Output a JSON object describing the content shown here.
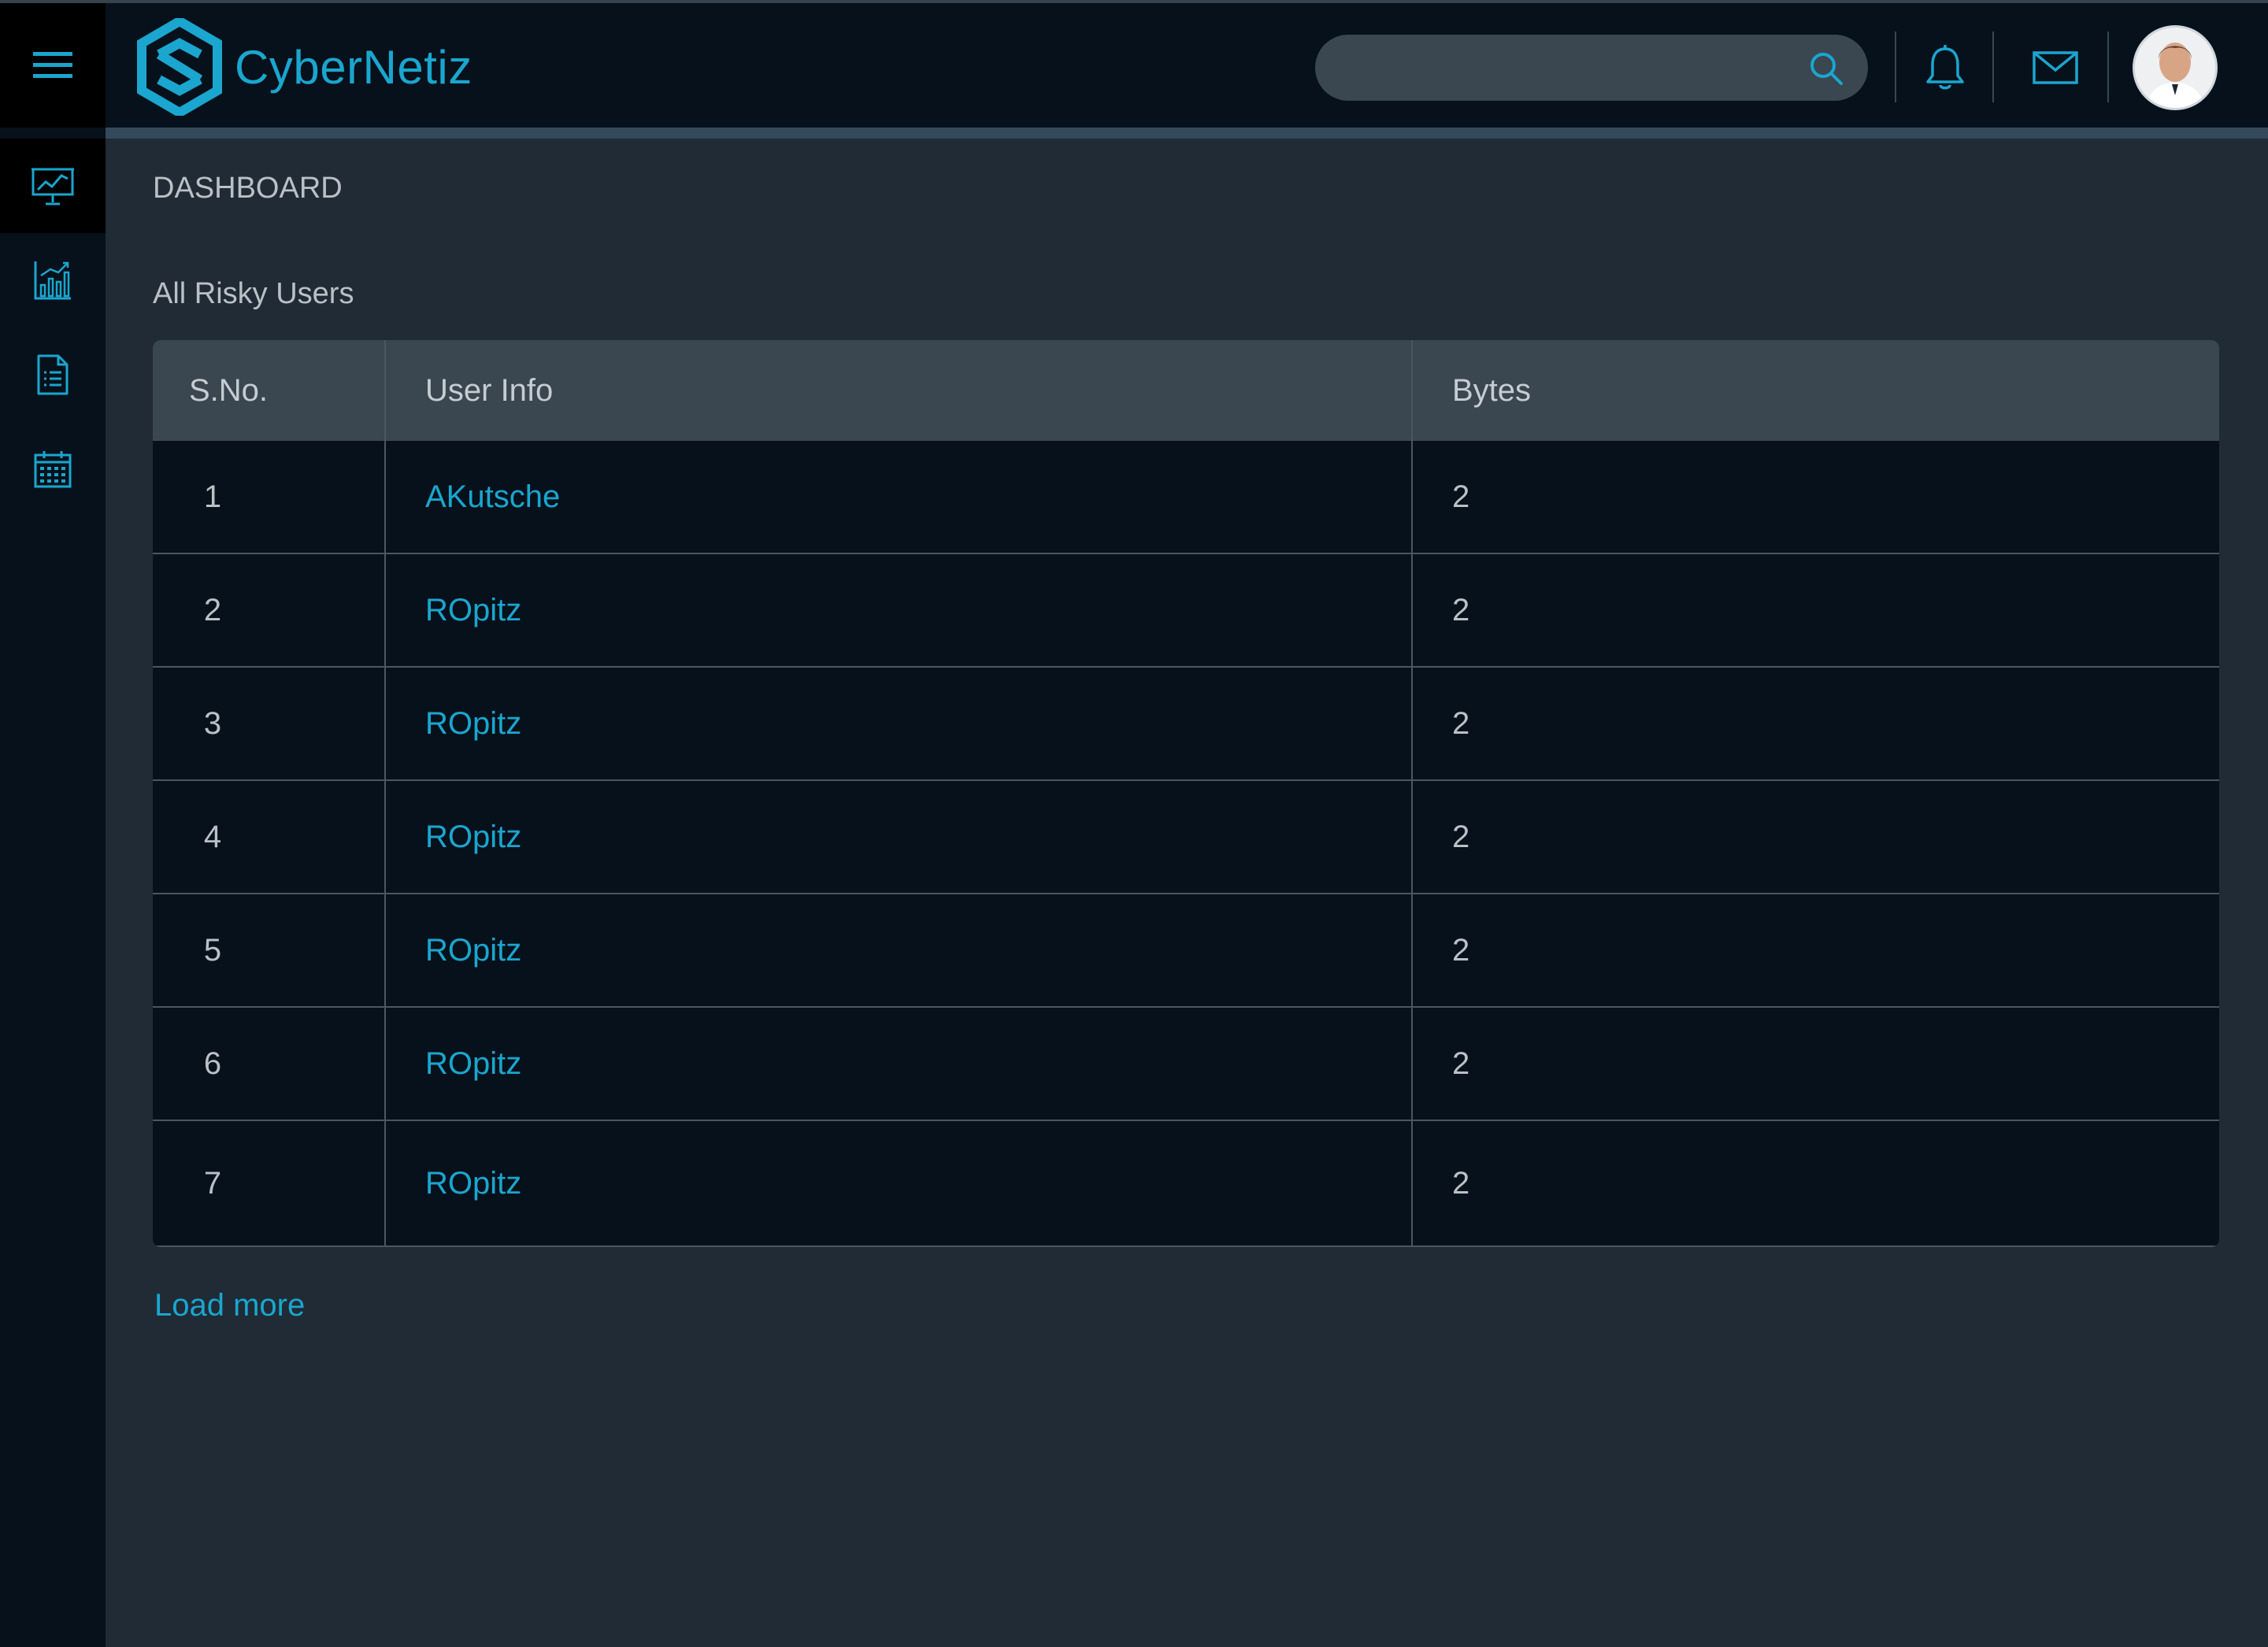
{
  "app": {
    "brand": "CyberNetiz"
  },
  "search": {
    "placeholder": "",
    "value": ""
  },
  "sidebar": {
    "items": [
      {
        "icon": "presentation-chart-icon",
        "active": true
      },
      {
        "icon": "bar-chart-icon",
        "active": false
      },
      {
        "icon": "document-list-icon",
        "active": false
      },
      {
        "icon": "calendar-icon",
        "active": false
      }
    ]
  },
  "page": {
    "title": "DASHBOARD"
  },
  "section": {
    "title": "All Risky Users"
  },
  "table": {
    "columns": [
      "S.No.",
      "User Info",
      "Bytes"
    ],
    "rows": [
      {
        "sno": "1",
        "user": "AKutsche",
        "bytes": "2"
      },
      {
        "sno": "2",
        "user": "ROpitz",
        "bytes": "2"
      },
      {
        "sno": "3",
        "user": "ROpitz",
        "bytes": "2"
      },
      {
        "sno": "4",
        "user": "ROpitz",
        "bytes": "2"
      },
      {
        "sno": "5",
        "user": "ROpitz",
        "bytes": "2"
      },
      {
        "sno": "6",
        "user": "ROpitz",
        "bytes": "2"
      },
      {
        "sno": "7",
        "user": "ROpitz",
        "bytes": "2"
      }
    ]
  },
  "actions": {
    "load_more": "Load more"
  },
  "colors": {
    "accent": "#1aa6cf",
    "background": "#202b35",
    "panel": "#07111b",
    "header": "#3a4650"
  }
}
